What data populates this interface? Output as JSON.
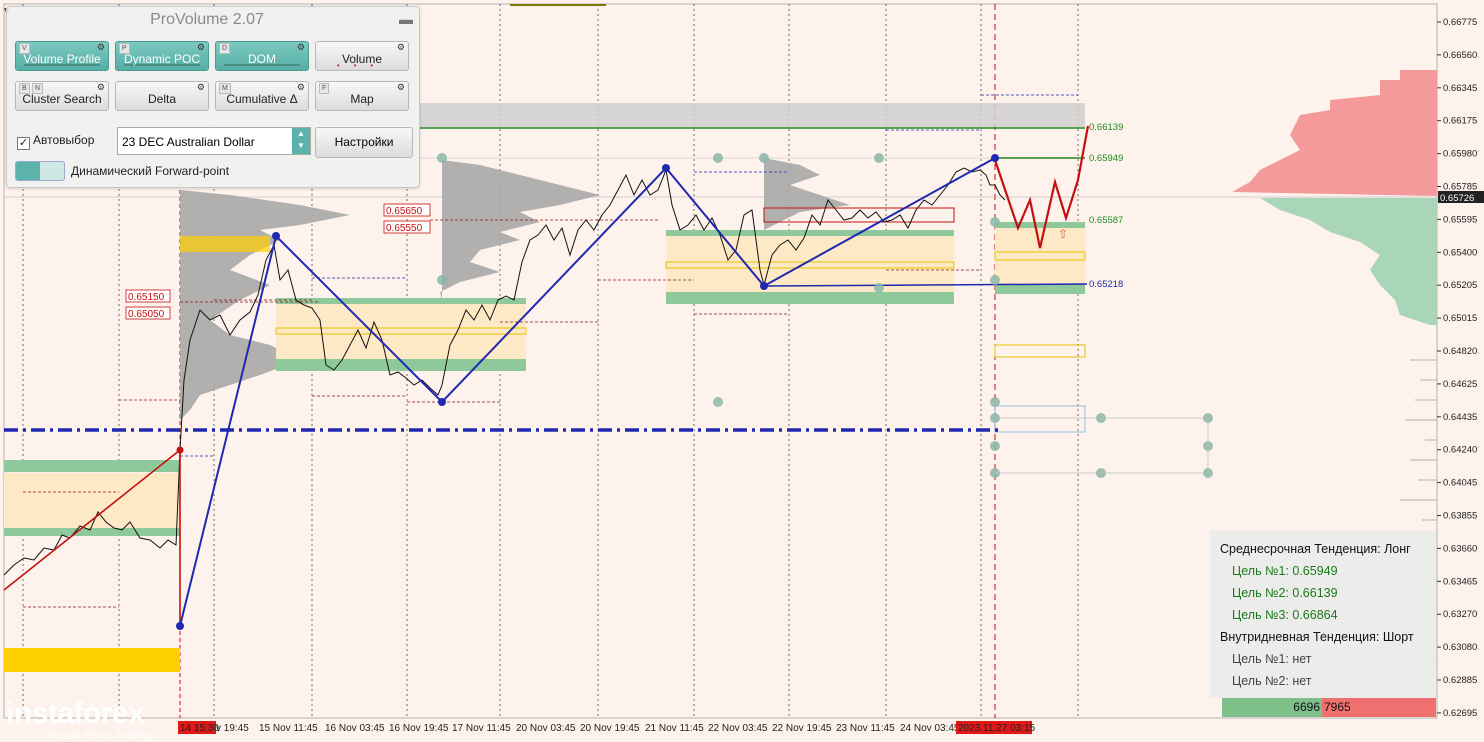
{
  "panel": {
    "title": "ProVolume 2.07",
    "buttons": [
      {
        "key": "V",
        "key2": "",
        "label": "Volume Profile",
        "active": true
      },
      {
        "key": "P",
        "key2": "",
        "label": "Dynamic POC",
        "active": true
      },
      {
        "key": "D",
        "key2": "",
        "label": "DOM",
        "active": true
      },
      {
        "key": "",
        "key2": "",
        "label": "Volume",
        "active": false
      },
      {
        "key": "B",
        "key2": "N",
        "label": "Cluster Search",
        "active": false
      },
      {
        "key": "",
        "key2": "",
        "label": "Delta",
        "active": false
      },
      {
        "key": "M",
        "key2": "",
        "label": "Cumulative Δ",
        "active": false
      },
      {
        "key": "F",
        "key2": "",
        "label": "Map",
        "active": false
      }
    ],
    "auto_select_label": "Автовыбор",
    "instrument": "23 DEC Australian Dollar",
    "settings_label": "Настройки",
    "forward_label": "Динамический Forward-point"
  },
  "price_axis": [
    "0.66775",
    "0.66560",
    "0.66345",
    "0.66175",
    "0.65980",
    "0.65785",
    "0.65595",
    "0.65400",
    "0.65205",
    "0.65015",
    "0.64820",
    "0.64625",
    "0.64435",
    "0.64240",
    "0.64045",
    "0.63855",
    "0.63660",
    "0.63465",
    "0.63270",
    "0.63080",
    "0.62885",
    "0.62695"
  ],
  "current_price": "0.65726",
  "time_axis": [
    "14 15:30",
    "v 19:45",
    "15 Nov 11:45",
    "16 Nov 03:45",
    "16 Nov 19:45",
    "17 Nov 11:45",
    "20 Nov 03:45",
    "20 Nov 19:45",
    "21 Nov 11:45",
    "22 Nov 03:45",
    "22 Nov 19:45",
    "23 Nov 11:45",
    "24 Nov 03:45",
    "2023.11.27 03:15"
  ],
  "price_tags": {
    "left": [
      "0.65150",
      "0.65050"
    ],
    "mid": [
      "0.65650",
      "0.65550"
    ],
    "right": [
      "0.66139",
      "0.65949",
      "0.65587",
      "0.65218"
    ]
  },
  "info_box": {
    "medium_trend": "Среднесрочная Тенденция: Лонг",
    "target1": "Цель №1: 0.65949",
    "target2": "Цель №2: 0.66139",
    "target3": "Цель №3: 0.66864",
    "intraday_trend": "Внутридневная Тенденция: Шорт",
    "intraday_target1": "Цель №1: нет",
    "intraday_target2": "Цель №2: нет"
  },
  "volume_bar": {
    "left": "6696",
    "right": "7965"
  },
  "logo": {
    "name": "instaforex",
    "tagline": "Instant Forex Trading"
  },
  "colors": {
    "background": "#fdf3ec",
    "accent": "#5bb3a9",
    "zigzag": "#1f28b0",
    "forecast": "#c41010"
  }
}
